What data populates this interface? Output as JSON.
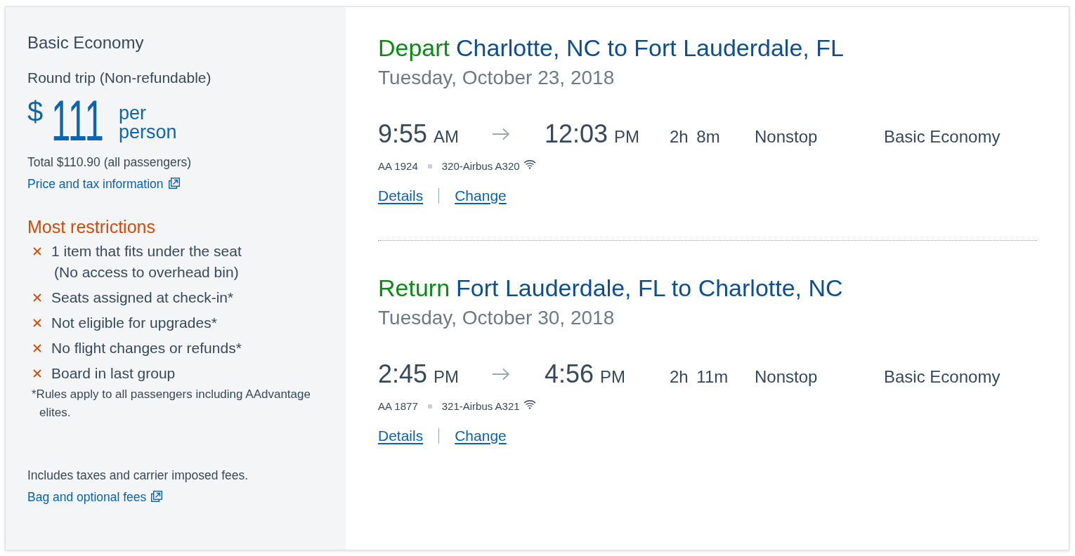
{
  "fare": {
    "title": "Basic Economy",
    "trip_type": "Round trip (Non-refundable)",
    "price": {
      "currency": "$",
      "amount": "111",
      "unit": "per person"
    },
    "total": "Total $110.90 (all passengers)",
    "price_link": "Price and tax information",
    "restrictions": {
      "title": "Most restrictions",
      "items": [
        {
          "text": "1 item that fits under the seat",
          "note": "(No access to overhead bin)"
        },
        {
          "text": "Seats assigned at check-in*"
        },
        {
          "text": "Not eligible for upgrades*"
        },
        {
          "text": "No flight changes or refunds*"
        },
        {
          "text": "Board in last group"
        }
      ],
      "footnote": "*Rules apply to all passengers including AAdvantage elites."
    },
    "fees_note": "Includes taxes and carrier imposed fees.",
    "fees_link": "Bag and optional fees"
  },
  "flights": [
    {
      "direction": "Depart",
      "route": "Charlotte, NC to Fort Lauderdale, FL",
      "date": "Tuesday, October 23, 2018",
      "depart_time": "9:55",
      "depart_period": "AM",
      "arrive_time": "12:03",
      "arrive_period": "PM",
      "duration": "2h 8m",
      "stops": "Nonstop",
      "cabin": "Basic Economy",
      "flight_number": "AA 1924",
      "aircraft": "320-Airbus A320",
      "wifi": true,
      "links": [
        "Details",
        "Change"
      ]
    },
    {
      "direction": "Return",
      "route": "Fort Lauderdale, FL to Charlotte, NC",
      "date": "Tuesday, October 30, 2018",
      "depart_time": "2:45",
      "depart_period": "PM",
      "arrive_time": "4:56",
      "arrive_period": "PM",
      "duration": "2h 11m",
      "stops": "Nonstop",
      "cabin": "Basic Economy",
      "flight_number": "AA 1877",
      "aircraft": "321-Airbus A321",
      "wifi": true,
      "links": [
        "Details",
        "Change"
      ]
    }
  ]
}
